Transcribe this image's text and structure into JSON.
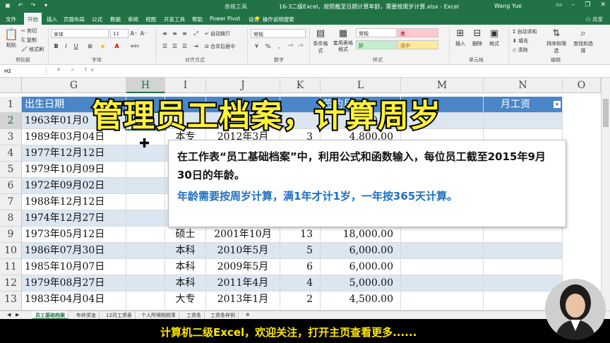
{
  "titlebar": {
    "tools_label": "表格工具",
    "file_title": "16-3二级Excel，按照截至日期计算年龄，需要按周岁计算.xlsx  -  Excel",
    "user": "Wang Yue",
    "qa_icons": [
      "save-icon",
      "undo-icon",
      "redo-icon",
      "quick-access-more-icon"
    ]
  },
  "tabs": [
    "文件",
    "开始",
    "插入",
    "页面布局",
    "公式",
    "数据",
    "审阅",
    "视图",
    "开发工具",
    "帮助",
    "Power Pivot",
    "设计"
  ],
  "active_tab": "开始",
  "tell_me": "操作说明搜索",
  "share": "共享",
  "ribbon": {
    "clipboard": {
      "cut": "剪切",
      "copy": "复制",
      "format_painter": "格式刷",
      "paste": "粘贴",
      "label": "剪贴板"
    },
    "font": {
      "name": "宋体",
      "size": "11",
      "label": "字体",
      "bold": "B",
      "italic": "I",
      "underline": "U",
      "increase": "A⁺",
      "decrease": "A⁻",
      "color": "A",
      "borders": "⊞",
      "fill": "◈",
      "phonetic": "wén"
    },
    "alignment": {
      "wrap": "自动换行",
      "merge": "合并后居中",
      "label": "对齐方式"
    },
    "number": {
      "format": "常规",
      "label": "数字",
      "percent": "%",
      "comma": ",",
      "currency": "¥"
    },
    "styles": {
      "conditional": "条件格式",
      "table": "套用表格格式",
      "normal": "常规",
      "bad": "差",
      "good": "好",
      "neutral": "适中",
      "label": "样式"
    },
    "cells": {
      "insert": "插入",
      "delete": "删除",
      "format": "格式",
      "label": "单元格"
    },
    "editing": {
      "autosum": "自动求和",
      "fill": "填充",
      "clear": "清除",
      "sort": "排序和筛选",
      "find": "查找和选择",
      "label": "编辑"
    }
  },
  "formula": {
    "namebox": "H2",
    "fx": "✕ ✓ fx",
    "value": ""
  },
  "columns": [
    "G",
    "H",
    "I",
    "J",
    "K",
    "L",
    "M",
    "N",
    "O"
  ],
  "rows": [
    "1",
    "2",
    "3",
    "4",
    "5",
    "6",
    "7",
    "8",
    "9",
    "10",
    "11",
    "12",
    "13"
  ],
  "header_row": {
    "G": "出生日期",
    "L": "签约月",
    "N": "月工资"
  },
  "data": [
    {
      "G": "1963年01月0",
      "I": "",
      "J": "",
      "K": "",
      "L": "40,00"
    },
    {
      "G": "1989年03月04日",
      "I": "本专",
      "J": "2012年3月",
      "K": "3",
      "L": "4,800.00"
    },
    {
      "G": "1977年12月12日",
      "I": "",
      "J": "",
      "K": "",
      "L": ""
    },
    {
      "G": "1979年10月09日",
      "I": "",
      "J": "",
      "K": "",
      "L": ""
    },
    {
      "G": "1972年09月02日",
      "I": "",
      "J": "",
      "K": "",
      "L": ""
    },
    {
      "G": "1988年12月12日",
      "I": "",
      "J": "",
      "K": "",
      "L": ""
    },
    {
      "G": "1974年12月27日",
      "I": "硕士",
      "J": "2001年8月",
      "K": "11",
      "L": "16,000.00"
    },
    {
      "G": "1973年05月12日",
      "I": "硕士",
      "J": "2001年10月",
      "K": "13",
      "L": "18,000.00"
    },
    {
      "G": "1986年07月30日",
      "I": "本科",
      "J": "2010年5月",
      "K": "5",
      "L": "6,000.00"
    },
    {
      "G": "1985年10月07日",
      "I": "本科",
      "J": "2009年5月",
      "K": "6",
      "L": "6,000.00"
    },
    {
      "G": "1979年08月27日",
      "I": "本科",
      "J": "2011年4月",
      "K": "4",
      "L": "5,000.00"
    },
    {
      "G": "1983年04月04日",
      "I": "大专",
      "J": "2013年1月",
      "K": "2",
      "L": "4,500.00"
    }
  ],
  "sheets": [
    "员工基础档案",
    "年终奖金",
    "12月工资表",
    "个人所得税税率",
    "工资条",
    "工资条样例"
  ],
  "active_sheet": "员工基础档案",
  "overlay": {
    "title": "管理员工档案，计算周岁",
    "line1": "在工作表“员工基础档案”中，利用公式和函数输入，每位员工截至2015年9月30日的年龄。",
    "line2": "年龄需要按周岁计算，满1年才计1岁，一年按365天计算。"
  },
  "bottom_caption": "计算机二级Excel，欢迎关注，打开主页查看更多......",
  "colors": {
    "excel_green": "#217346",
    "header_blue": "#4a86c8",
    "band_blue": "#dce6f1",
    "title_yellow": "#fff13a",
    "popup_blue": "#1f6fc1"
  }
}
